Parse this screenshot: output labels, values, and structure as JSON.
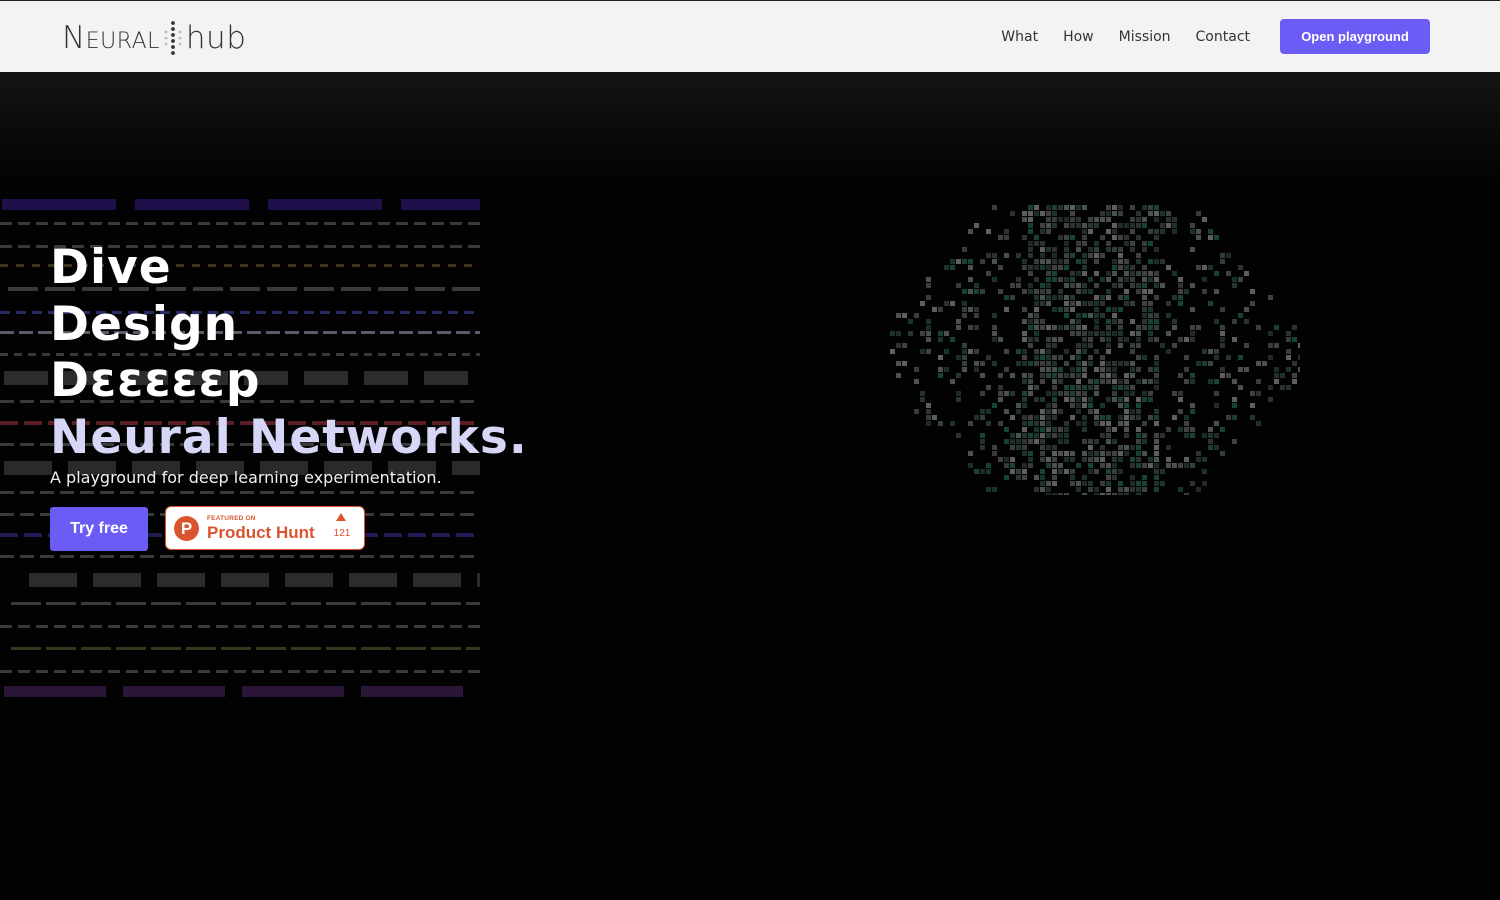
{
  "header": {
    "logo": {
      "left": "Neural",
      "right": "hub"
    },
    "nav": [
      "What",
      "How",
      "Mission",
      "Contact"
    ],
    "cta_label": "Open playground"
  },
  "hero": {
    "headline": [
      "Dive",
      "Design",
      "Dεεεεεp",
      "Neural Networks."
    ],
    "subtitle": "A playground for deep learning experimentation.",
    "primary_button": "Try free",
    "badge": {
      "featured": "FEATURED ON",
      "name": "Product Hunt",
      "letter": "P",
      "upvotes": "121"
    }
  },
  "colors": {
    "accent": "#6b5cf6",
    "header_bg": "#f3f3f3",
    "hero_bg": "#020202",
    "headline_accent": "#d6d6f6",
    "product_hunt": "#da552f"
  },
  "icons": [
    "neural-dots-logo-mark",
    "upvote-arrow-icon",
    "product-hunt-logo-icon"
  ]
}
